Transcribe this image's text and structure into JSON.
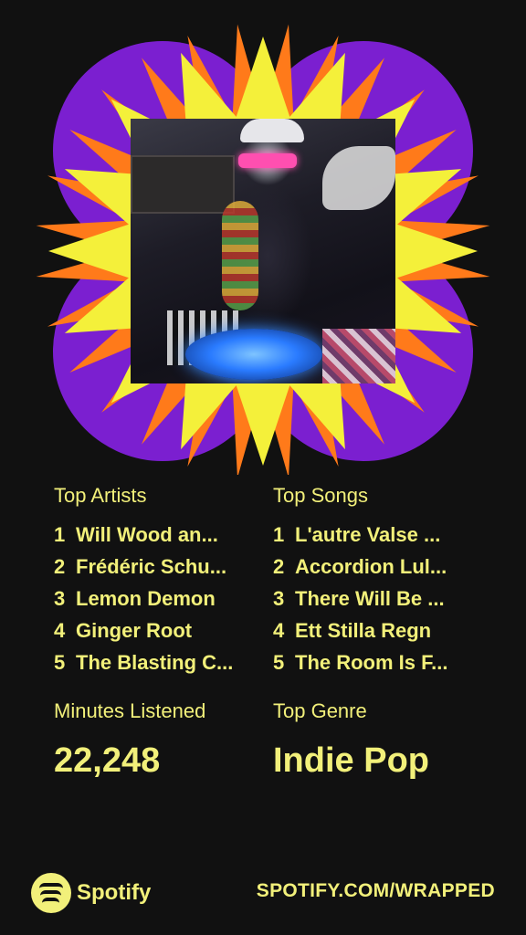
{
  "stats": {
    "top_artists_label": "Top Artists",
    "top_songs_label": "Top Songs",
    "top_artists": [
      {
        "rank": "1",
        "name": "Will Wood an..."
      },
      {
        "rank": "2",
        "name": "Frédéric Schu..."
      },
      {
        "rank": "3",
        "name": "Lemon Demon"
      },
      {
        "rank": "4",
        "name": "Ginger Root"
      },
      {
        "rank": "5",
        "name": "The Blasting C..."
      }
    ],
    "top_songs": [
      {
        "rank": "1",
        "name": "L'autre Valse ..."
      },
      {
        "rank": "2",
        "name": "Accordion Lul..."
      },
      {
        "rank": "3",
        "name": "There Will Be ..."
      },
      {
        "rank": "4",
        "name": "Ett Stilla Regn"
      },
      {
        "rank": "5",
        "name": "The Room Is F..."
      }
    ],
    "minutes_label": "Minutes Listened",
    "minutes_value": "22,248",
    "genre_label": "Top Genre",
    "genre_value": "Indie Pop"
  },
  "footer": {
    "brand": "Spotify",
    "url": "SPOTIFY.COM/WRAPPED"
  },
  "colors": {
    "background": "#111111",
    "accent_yellow": "#f2f07a",
    "purple": "#7b1fd0",
    "orange": "#ff7a1a",
    "star_yellow": "#f4f03a"
  },
  "icons": {
    "logo": "spotify-logo-icon"
  }
}
